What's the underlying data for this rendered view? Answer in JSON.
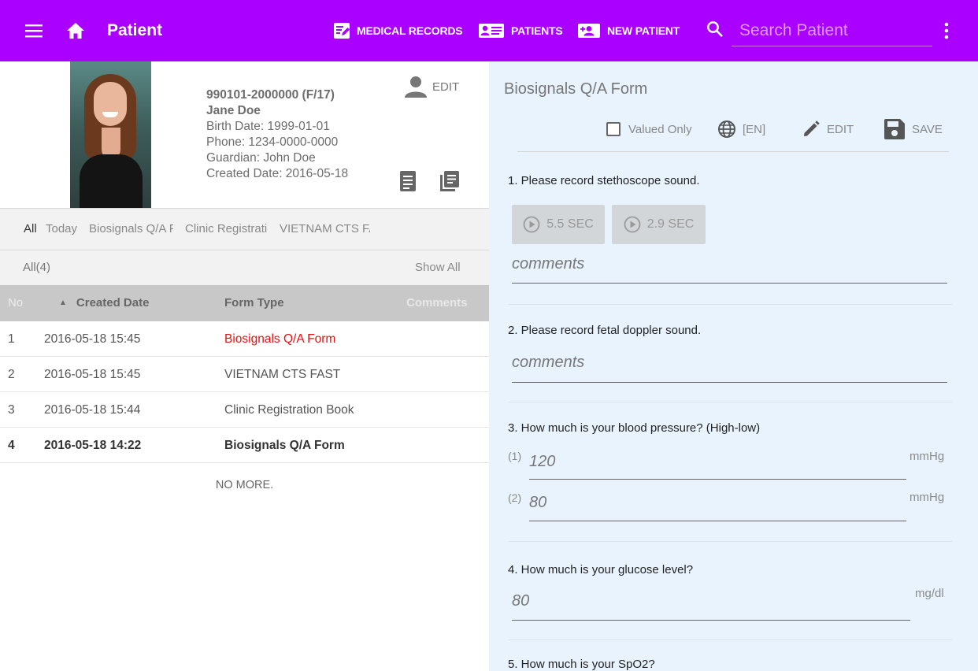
{
  "appbar": {
    "title": "Patient",
    "nav": {
      "medical_records": "MEDICAL RECORDS",
      "patients": "PATIENTS",
      "new_patient": "NEW PATIENT"
    },
    "search_placeholder": "Search Patient",
    "color": "#aa00ff"
  },
  "patient": {
    "id": "990101-2000000 (F/17)",
    "name": "Jane Doe",
    "birth_date": "Birth Date: 1999-01-01",
    "phone": "Phone: 1234-0000-0000",
    "guardian": "Guardian: John Doe",
    "created_date": "Created Date: 2016-05-18",
    "edit_label": "EDIT"
  },
  "filters": [
    "All",
    "Today",
    "Biosignals Q/A Form",
    "Clinic Registration Book",
    "VIETNAM CTS FAST"
  ],
  "records": {
    "count_label": "All(4)",
    "show_all": "Show All",
    "columns": {
      "no": "No",
      "created": "Created Date",
      "form": "Form Type",
      "comments": "Comments"
    },
    "rows": [
      {
        "no": "1",
        "date": "2016-05-18 15:45",
        "form": "Biosignals Q/A Form"
      },
      {
        "no": "2",
        "date": "2016-05-18 15:45",
        "form": "VIETNAM CTS FAST"
      },
      {
        "no": "3",
        "date": "2016-05-18 15:44",
        "form": "Clinic Registration Book"
      },
      {
        "no": "4",
        "date": "2016-05-18 14:22",
        "form": "Biosignals Q/A Form"
      }
    ],
    "no_more": "NO MORE.",
    "highlight_color": "#e81010"
  },
  "form": {
    "title": "Biosignals Q/A Form",
    "toolbar": {
      "valued_only": "Valued Only",
      "lang": "[EN]",
      "edit": "EDIT",
      "save": "SAVE"
    },
    "q1": {
      "text": "1. Please record stethoscope sound.",
      "audio": [
        "5.5 SEC",
        "2.9 SEC"
      ],
      "comment": "comments"
    },
    "q2": {
      "text": "2. Please record fetal doppler sound.",
      "comment": "comments"
    },
    "q3": {
      "text": "3. How much is your blood pressure? (High-low)",
      "values": [
        {
          "index": "(1)",
          "value": "120",
          "unit": "mmHg"
        },
        {
          "index": "(2)",
          "value": "80",
          "unit": "mmHg"
        }
      ]
    },
    "q4": {
      "text": "4. How much is your glucose level?",
      "value": "80",
      "unit": "mg/dl"
    },
    "q5": {
      "text": "5. How much is your SpO2?"
    },
    "background": "#e8f3fe"
  }
}
